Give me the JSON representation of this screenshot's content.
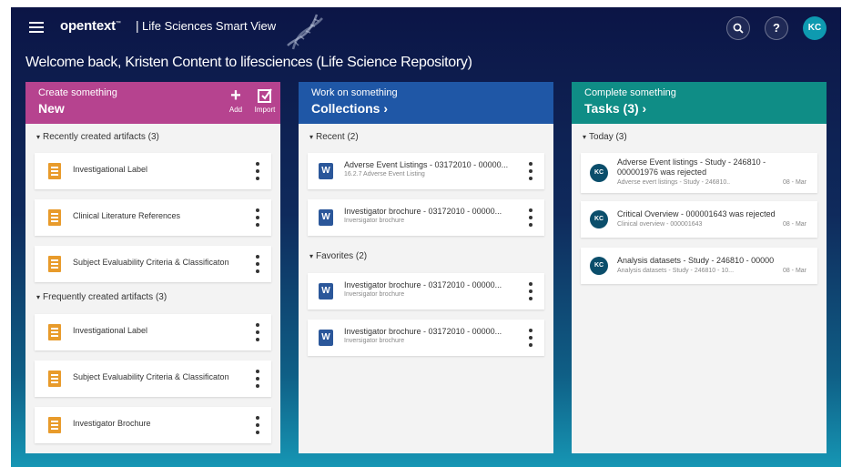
{
  "header": {
    "brand": "opentext",
    "brand_tm": "™",
    "separator": "|",
    "app_name": "Life Sciences Smart View",
    "search_icon": "search-icon",
    "help_label": "?",
    "user_initials": "KC"
  },
  "welcome": "Welcome back, Kristen Content to lifesciences (Life Science Repository)",
  "panels": {
    "create": {
      "small": "Create something",
      "big": "New",
      "add_label": "Add",
      "import_label": "Import",
      "recent_label": "Recently created artifacts (3)",
      "recent": [
        "Investigational Label",
        "Clinical Literature References",
        "Subject Evaluability Criteria & Classificaton"
      ],
      "frequent_label": "Frequently created artifacts (3)",
      "frequent": [
        "Investigational Label",
        "Subject Evaluability Criteria & Classificaton",
        "Investigator Brochure"
      ]
    },
    "collections": {
      "small": "Work on something",
      "big": "Collections ›",
      "recent_label": "Recent (2)",
      "recent": [
        {
          "title": "Adverse Event Listings - 03172010 - 00000...",
          "sub": "16.2.7 Adverse Event Listing"
        },
        {
          "title": "Investigator brochure - 03172010 - 00000...",
          "sub": "Inversigator brochure"
        }
      ],
      "favorites_label": "Favorites (2)",
      "favorites": [
        {
          "title": "Investigator brochure - 03172010 - 00000...",
          "sub": "Inversigator brochure"
        },
        {
          "title": "Investigator brochure - 03172010 - 00000...",
          "sub": "Inversigator brochure"
        }
      ],
      "word_glyph": "W"
    },
    "tasks": {
      "small": "Complete something",
      "big": "Tasks (3) ›",
      "today_label": "Today (3)",
      "items": [
        {
          "initials": "KC",
          "line1": "Adverse Event listings - Study - 246810 -",
          "line2": "000001976 was rejected",
          "sub": "Adverse evert listings - Study - 246810..",
          "date": "08 - Mar"
        },
        {
          "initials": "KC",
          "line1": "Critical Overview - 000001643 was rejected",
          "sub": "Clinical overview - 000001643",
          "date": "08 - Mar"
        },
        {
          "initials": "KC",
          "line1": "Analysis datasets - Study - 246810 - 00000",
          "sub": "Analysis datasets - Study - 246810 - 10...",
          "date": "08 - Mar"
        }
      ]
    }
  },
  "colors": {
    "create_header": "#b6438f",
    "collections_header": "#1f57a6",
    "tasks_header": "#0f8d86",
    "doc_icon": "#e89b2b",
    "word_icon": "#2b579a"
  }
}
